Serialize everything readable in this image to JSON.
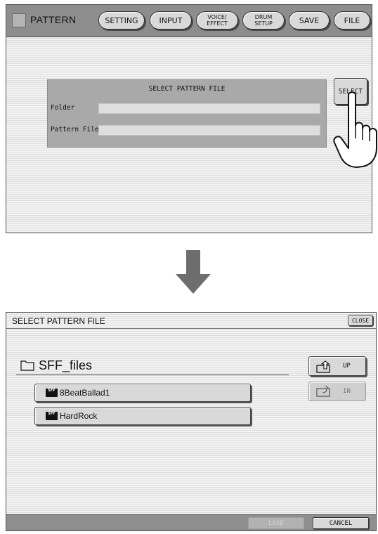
{
  "top_screen": {
    "title": "PATTERN",
    "tabs": [
      {
        "label": "SETTING"
      },
      {
        "label": "INPUT"
      },
      {
        "label": "VOICE/\nEFFECT"
      },
      {
        "label": "DRUM\nSETUP"
      },
      {
        "label": "SAVE"
      },
      {
        "label": "FILE"
      }
    ],
    "panel": {
      "title": "SELECT PATTERN FILE",
      "folder_label": "Folder",
      "folder_value": "",
      "pattern_file_label": "Pattern File",
      "pattern_file_value": ""
    },
    "select_button": "SELECT"
  },
  "bottom_screen": {
    "title": "SELECT PATTERN FILE",
    "close_button": "CLOSE",
    "current_folder": "SFF_files",
    "files": [
      {
        "badge": "SFF",
        "name": "8BeatBallad1"
      },
      {
        "badge": "SFF",
        "name": "HardRock"
      }
    ],
    "up_button": "UP",
    "in_button": "IN",
    "load_button": "LOAD",
    "cancel_button": "CANCEL"
  },
  "icons": {
    "pointing_hand": "pointing-hand-icon",
    "arrow": "down-arrow-icon",
    "folder": "folder-icon",
    "folder_up": "folder-up-icon",
    "folder_in": "folder-in-icon",
    "file_badge": "sff-file-icon"
  },
  "colors": {
    "screen_background": "#ececec",
    "top_bar": "#8d8d8d",
    "panel": "#a9a9a9",
    "button_face": "#d9d9d9",
    "arrow": "#6d6d6d"
  }
}
